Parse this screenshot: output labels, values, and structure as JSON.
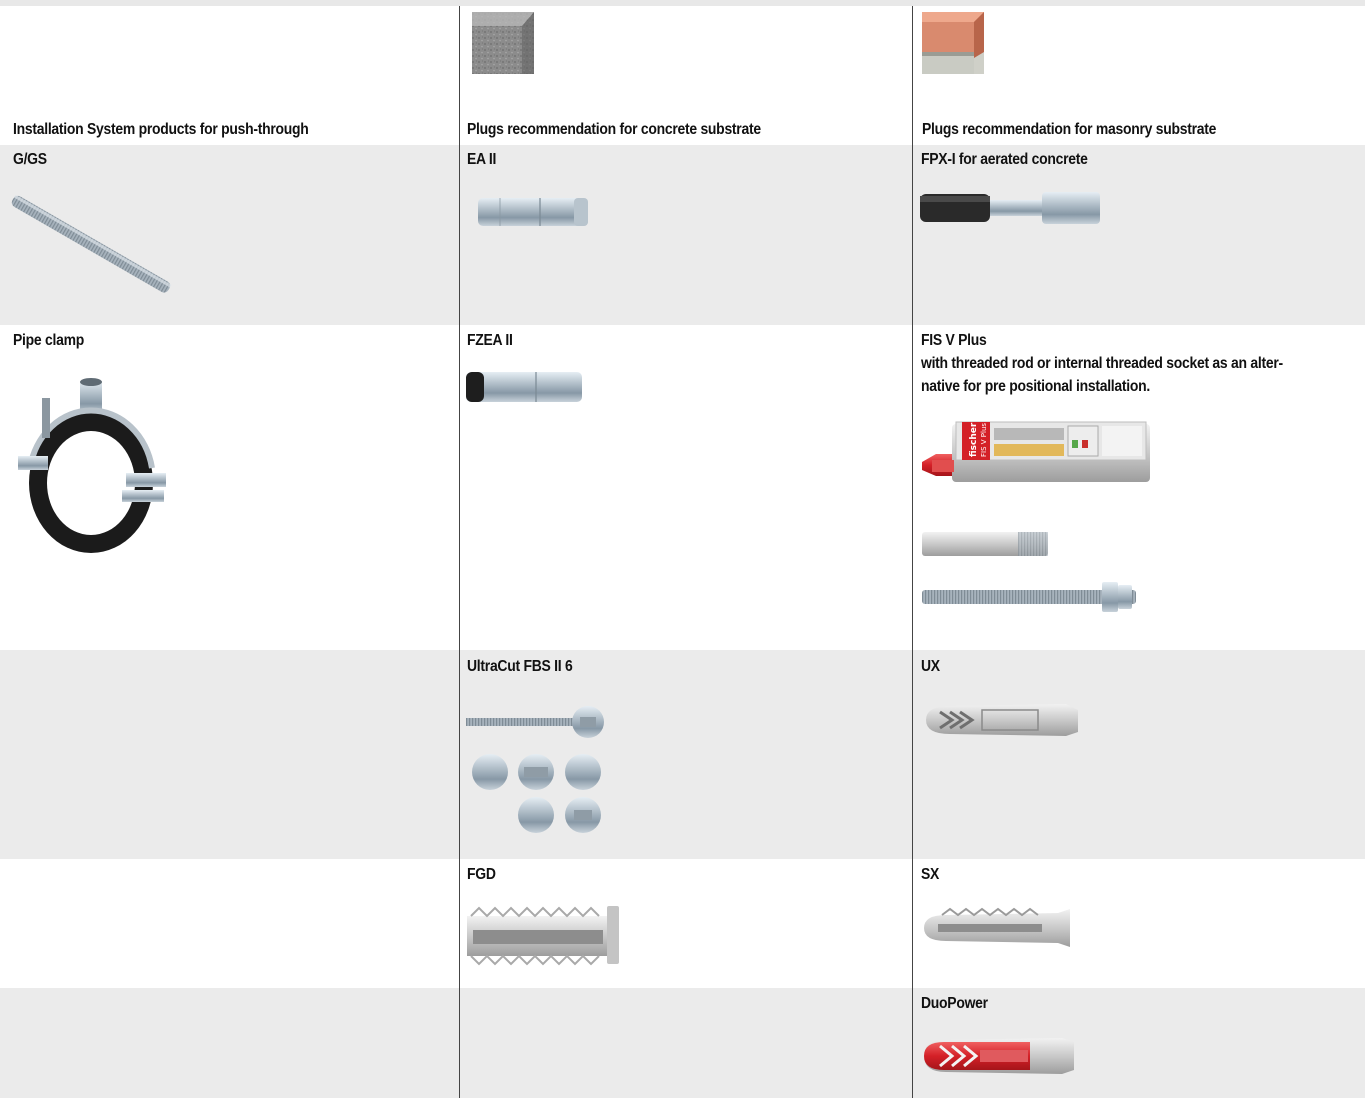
{
  "header": {
    "col1": "Installation System products for push-through",
    "col2": "Plugs recommendation for concrete substrate",
    "col3": "Plugs recommendation for masonry substrate",
    "col2_swatch": "concrete-substrate-sample",
    "col3_swatch": "masonry-substrate-sample"
  },
  "rows": [
    {
      "col1": "G/GS",
      "col2": "EA II",
      "col3": "FPX-I for aerated concrete"
    },
    {
      "col1": "Pipe clamp",
      "col2": "FZEA II",
      "col3": "FIS V Plus",
      "col3_note_line1": "with threaded rod or internal threaded socket as an alter-",
      "col3_note_line2": "native for pre positional installation.",
      "cartridge_brand": "fischer",
      "cartridge_product": "FIS V Plus"
    },
    {
      "col1": "",
      "col2": "UltraCut FBS II 6",
      "col3": "UX"
    },
    {
      "col1": "",
      "col2": "FGD",
      "col3": "SX"
    },
    {
      "col1": "",
      "col2": "",
      "col3": "DuoPower"
    }
  ],
  "colors": {
    "row_shade": "#ebebeb",
    "divider": "#444444",
    "brand_red": "#d42027"
  }
}
